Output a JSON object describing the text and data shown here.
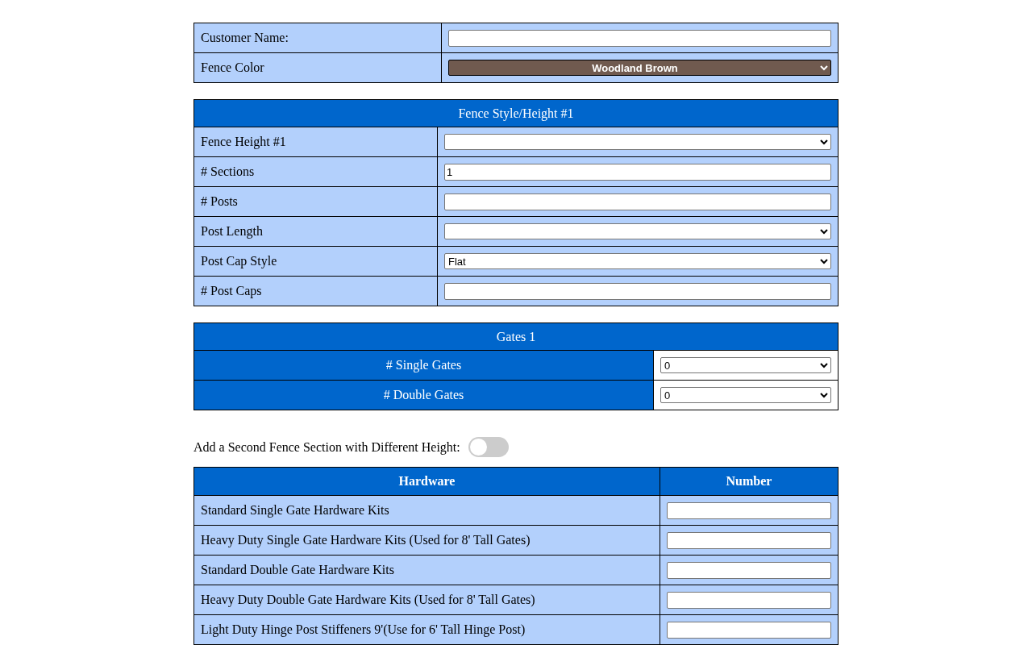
{
  "customer": [
    {
      "label": "Customer Name:",
      "kind": "text"
    },
    {
      "label": "Fence Color",
      "kind": "color-select",
      "value": "Woodland Brown"
    }
  ],
  "fence_style": {
    "title": "Fence Style/Height #1",
    "rows": [
      {
        "label": "Fence Height #1",
        "kind": "select"
      },
      {
        "label": "# Sections",
        "kind": "text",
        "value": "1"
      },
      {
        "label": "# Posts",
        "kind": "text"
      },
      {
        "label": "Post Length",
        "kind": "select"
      },
      {
        "label": "Post Cap Style",
        "kind": "select",
        "value": "Flat"
      },
      {
        "label": "# Post Caps",
        "kind": "text"
      }
    ]
  },
  "gates": {
    "title": "Gates 1",
    "rows": [
      {
        "label": "# Single Gates",
        "value": "0"
      },
      {
        "label": "# Double Gates",
        "value": "0"
      }
    ]
  },
  "second_section": {
    "label": "Add a Second Fence Section with Different Height:",
    "on": false
  },
  "hardware": {
    "columns": [
      "Hardware",
      "Number"
    ],
    "rows": [
      {
        "label": "Standard Single Gate Hardware Kits"
      },
      {
        "label": "Heavy Duty Single Gate Hardware Kits (Used for 8' Tall Gates)"
      },
      {
        "label": "Standard Double Gate Hardware Kits"
      },
      {
        "label": "Heavy Duty Double Gate Hardware Kits (Used for 8' Tall Gates)"
      },
      {
        "label": "Light Duty Hinge Post Stiffeners 9'(Use for 6' Tall Hinge Post)"
      }
    ]
  }
}
